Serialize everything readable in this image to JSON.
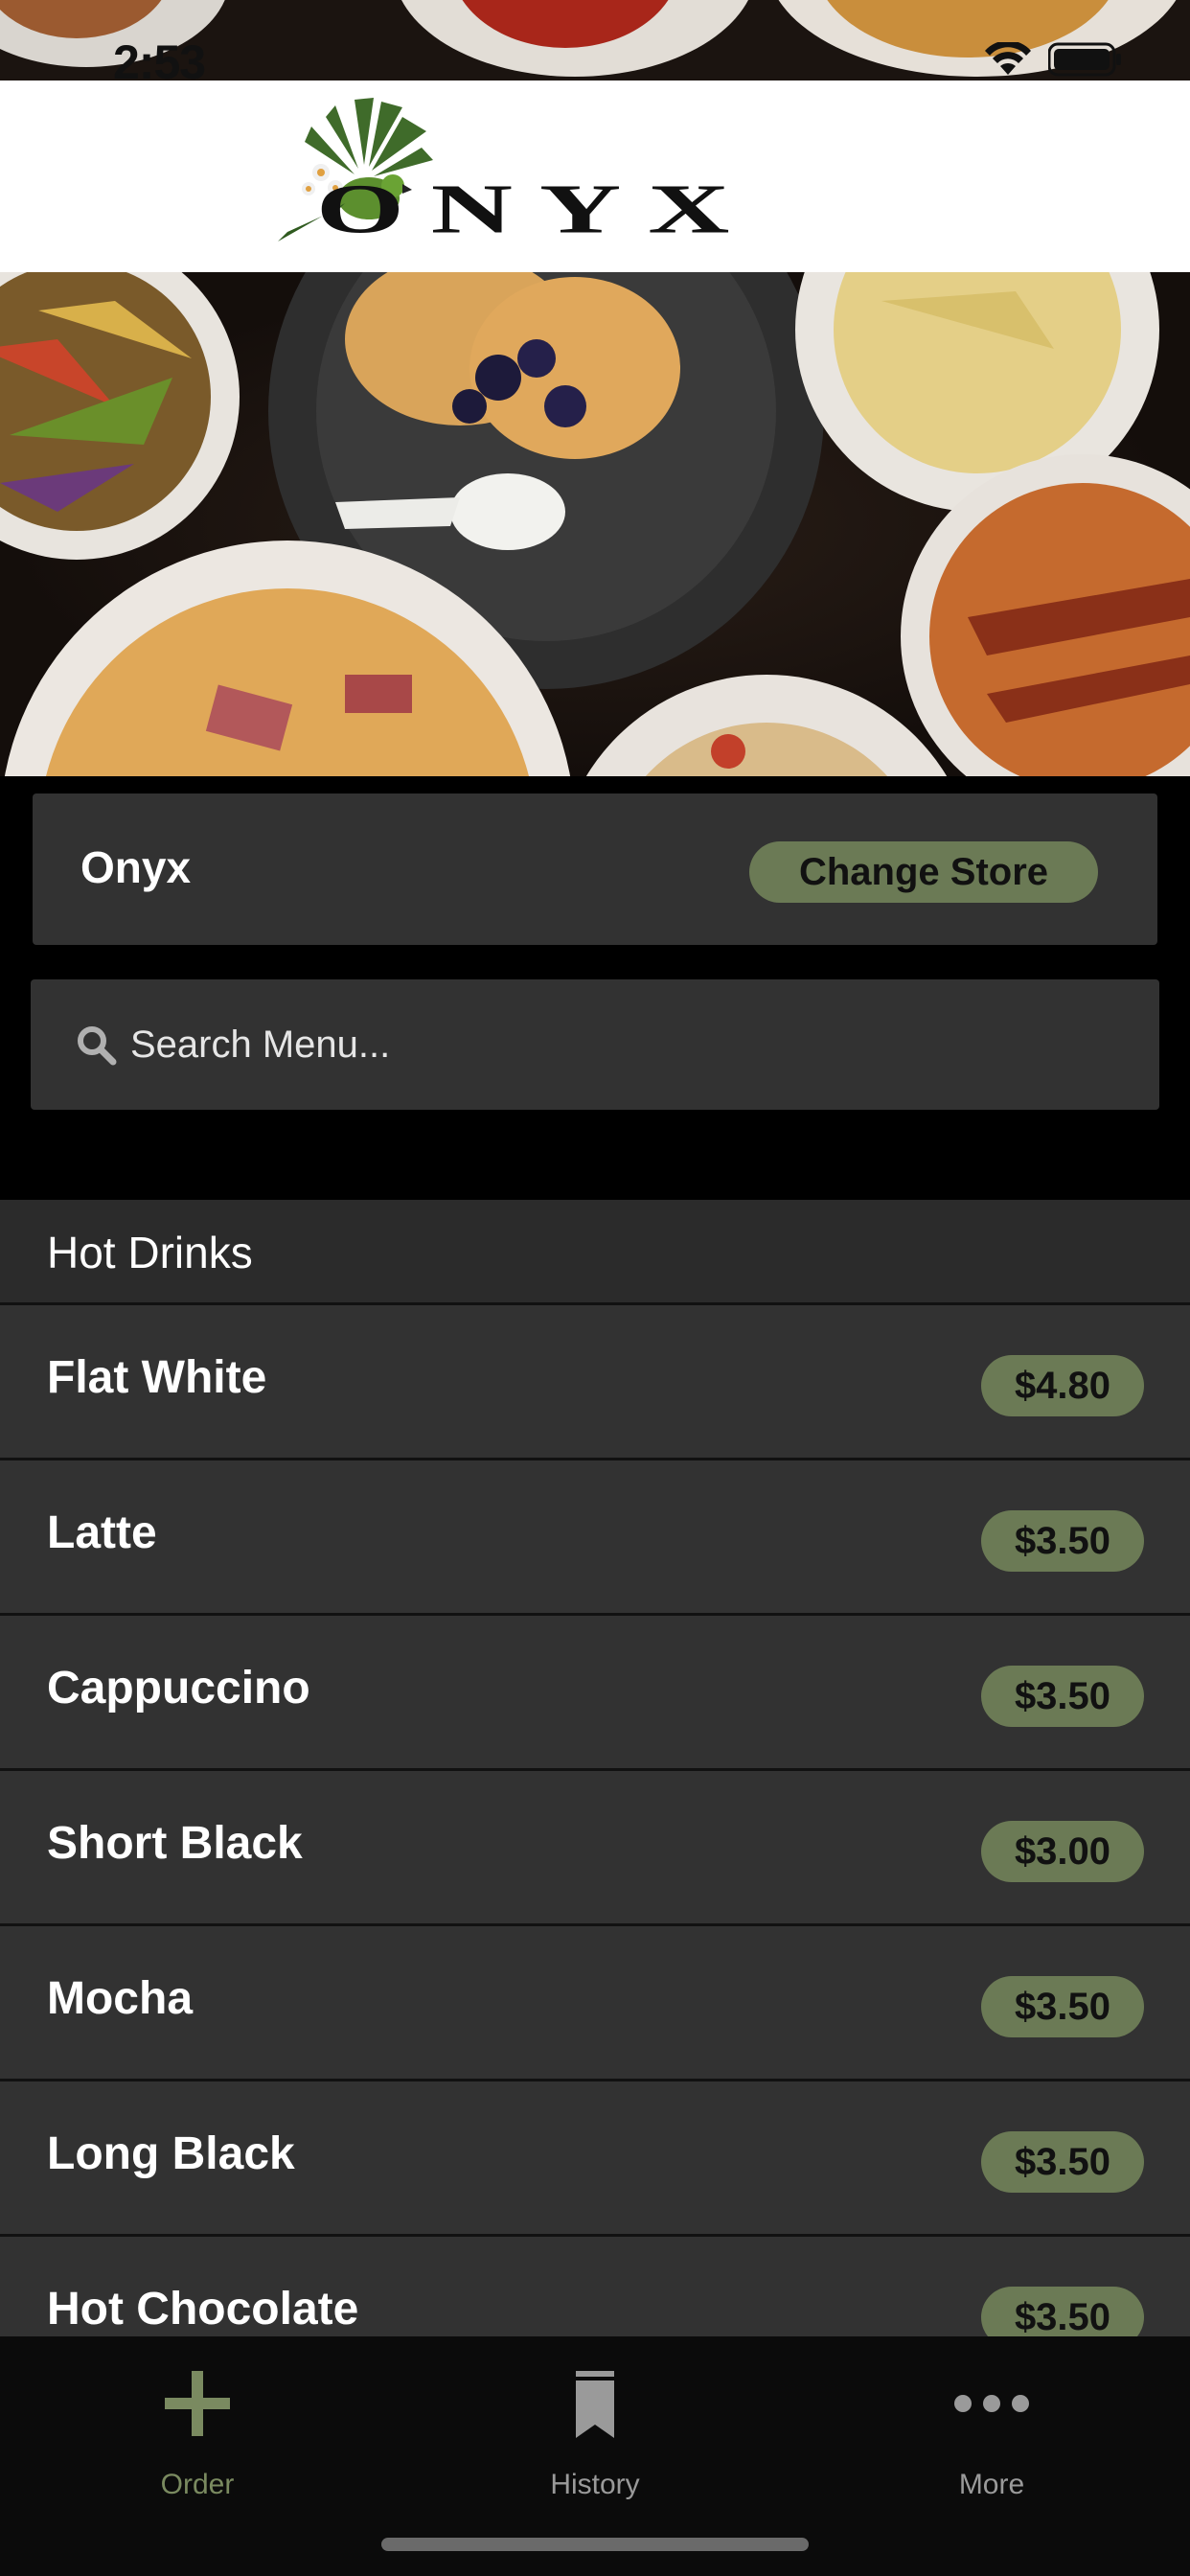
{
  "status_bar": {
    "time": "2:53"
  },
  "header": {
    "logo_text": "ONYX"
  },
  "store": {
    "name": "Onyx",
    "change_store_label": "Change Store"
  },
  "search": {
    "placeholder": "Search Menu..."
  },
  "menu": {
    "section_title": "Hot Drinks",
    "items": [
      {
        "name": "Flat White",
        "price": "$4.80"
      },
      {
        "name": "Latte",
        "price": "$3.50"
      },
      {
        "name": "Cappuccino",
        "price": "$3.50"
      },
      {
        "name": "Short Black",
        "price": "$3.00"
      },
      {
        "name": "Mocha",
        "price": "$3.50"
      },
      {
        "name": "Long Black",
        "price": "$3.50"
      },
      {
        "name": "Hot Chocolate",
        "price": "$3.50"
      }
    ]
  },
  "tabs": [
    {
      "label": "Order",
      "icon": "plus-icon",
      "active": true
    },
    {
      "label": "History",
      "icon": "bookmark-icon",
      "active": false
    },
    {
      "label": "More",
      "icon": "more-dots-icon",
      "active": false
    }
  ],
  "colors": {
    "accent": "#6b7a55",
    "active_tab": "#7a8a60",
    "inactive_tab": "#9a9a9a",
    "card_bg": "#323232"
  }
}
